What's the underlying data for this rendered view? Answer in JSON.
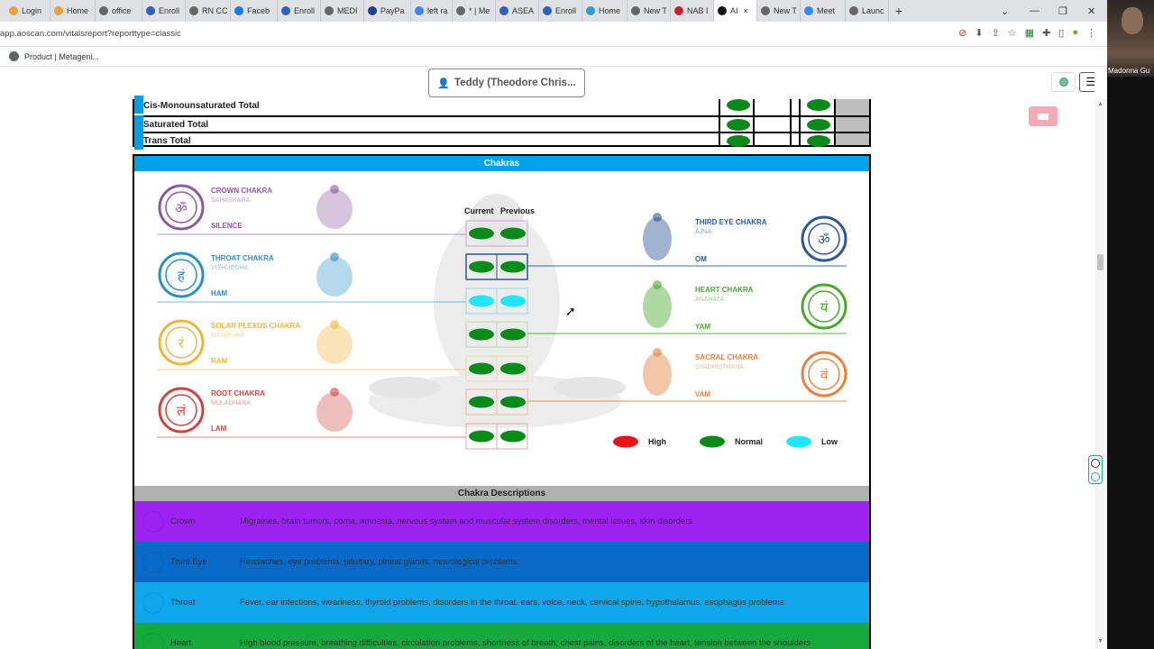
{
  "browser": {
    "tabs": [
      {
        "label": "Login",
        "color": "#e8a23a"
      },
      {
        "label": "Home",
        "color": "#e8a23a"
      },
      {
        "label": "office",
        "color": "#666666"
      },
      {
        "label": "Enroll",
        "color": "#2b62c0"
      },
      {
        "label": "RN CC",
        "color": "#666666"
      },
      {
        "label": "Faceb",
        "color": "#1877f2"
      },
      {
        "label": "Enroll",
        "color": "#2b62c0"
      },
      {
        "label": "MEDI",
        "color": "#666666"
      },
      {
        "label": "PayPa",
        "color": "#1f3f8f"
      },
      {
        "label": "left ra",
        "color": "#4285f4"
      },
      {
        "label": "* | Me",
        "color": "#666666"
      },
      {
        "label": "ASEA",
        "color": "#2b62c0"
      },
      {
        "label": "Enroll",
        "color": "#2b62c0"
      },
      {
        "label": "Home",
        "color": "#2b9cd8"
      },
      {
        "label": "New T",
        "color": "#666666"
      },
      {
        "label": "NAB I",
        "color": "#cc1f2f"
      },
      {
        "label": "AI",
        "color": "#111111",
        "active": true
      },
      {
        "label": "New T",
        "color": "#666666"
      },
      {
        "label": "Meet",
        "color": "#2d8cff"
      },
      {
        "label": "Launc",
        "color": "#666666"
      }
    ],
    "new_tab": "+",
    "close_tab": "×",
    "url": "app.aoscan.com/vitalsreport?reporttype=classic",
    "bookmark": "Product | Metageni..."
  },
  "webcam": {
    "name": "Madonna Gu"
  },
  "page": {
    "user_button": "Teddy (Theodore Chris..."
  },
  "fat_rows": [
    {
      "label": "Cis-Monounsaturated Total"
    },
    {
      "label": "Saturated Total"
    },
    {
      "label": "Trans Total"
    }
  ],
  "chakras": {
    "header": "Chakras",
    "current_label": "Current",
    "previous_label": "Previous",
    "left": [
      {
        "name": "CROWN CHAKRA",
        "sub": "SAHASRARA",
        "mantra": "SILENCE",
        "color": "#8a5a9b",
        "symbol": "ॐ",
        "level_current": "normal",
        "level_previous": "normal"
      },
      {
        "name": "THROAT CHAKRA",
        "sub": "VISHUDDHA",
        "mantra": "HAM",
        "color": "#2b8ec4",
        "symbol": "हं",
        "level_current": "normal",
        "level_previous": "normal"
      },
      {
        "name": "SOLAR PLEXUS CHAKRA",
        "sub": "MANIPURA",
        "mantra": "RAM",
        "color": "#f0b53b",
        "symbol": "रं",
        "level_current": "normal",
        "level_previous": "normal"
      },
      {
        "name": "ROOT CHAKRA",
        "sub": "MULADHARA",
        "mantra": "LAM",
        "color": "#c9453f",
        "symbol": "लं",
        "level_current": "normal",
        "level_previous": "normal"
      }
    ],
    "right": [
      {
        "name": "THIRD EYE CHAKRA",
        "sub": "AJNA",
        "mantra": "OM",
        "color": "#2f5596",
        "symbol": "ॐ"
      },
      {
        "name": "HEART CHAKRA",
        "sub": "ANAHATA",
        "mantra": "YAM",
        "color": "#4aa82f",
        "symbol": "यं"
      },
      {
        "name": "SACRAL CHAKRA",
        "sub": "SVADHISTHANA",
        "mantra": "VAM",
        "color": "#e6813f",
        "symbol": "वं"
      }
    ],
    "pill_rows": [
      {
        "current": "normal",
        "previous": "normal"
      },
      {
        "current": "normal",
        "previous": "normal"
      },
      {
        "current": "low",
        "previous": "low"
      },
      {
        "current": "normal",
        "previous": "normal"
      },
      {
        "current": "normal",
        "previous": "normal"
      },
      {
        "current": "normal",
        "previous": "normal"
      },
      {
        "current": "normal",
        "previous": "normal"
      }
    ],
    "legend": [
      {
        "label": "High",
        "color": "#e8131a"
      },
      {
        "label": "Normal",
        "color": "#0a8a1a"
      },
      {
        "label": "Low",
        "color": "#22e6f5"
      }
    ]
  },
  "descriptions": {
    "header": "Chakra Descriptions",
    "rows": [
      {
        "name": "Crown",
        "text": "Migraines, brain tumors, coma, amnesia, nervous system and muscular system disorders, mental issues, skin disorders",
        "color": "#9c22f0"
      },
      {
        "name": "Third Eye",
        "text": "Headaches, eye problems, pituitary, pineal glands, neurological problems",
        "color": "#0a69c6"
      },
      {
        "name": "Throat",
        "text": "Fever, ear infections, weariness, thyroid problems, disorders in the throat, ears, voice, neck, cervical spine, hypothalamus, esophagus problems",
        "color": "#10a6ec"
      },
      {
        "name": "Heart",
        "text": "High blood pressure, breathing difficulties, circulation problems, shortness of breath, chest pains, disorders of the heart, tension between the shoulders",
        "color": "#17a83e"
      }
    ]
  }
}
